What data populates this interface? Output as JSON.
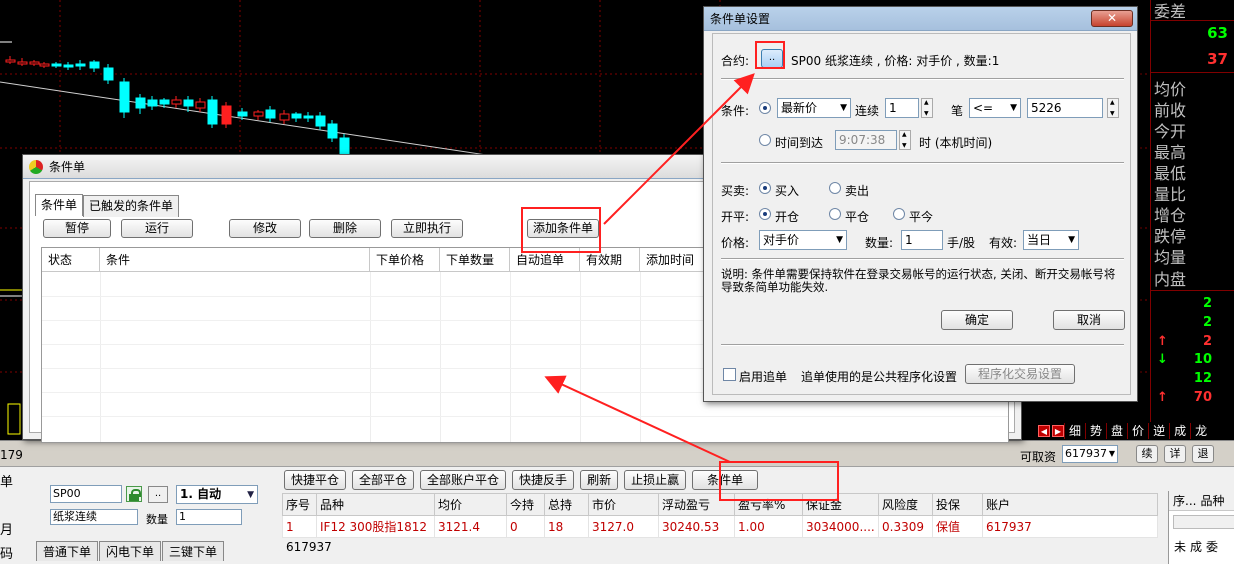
{
  "quote_panel": {
    "labels": [
      "委差",
      "均价",
      "前收",
      "今开",
      "最高",
      "最低",
      "量比",
      "增仓",
      "跌停",
      "均量",
      "内盘"
    ],
    "values": [
      {
        "text": "63",
        "color": "#00ff00"
      },
      {
        "text": "37",
        "color": "#ff3030"
      }
    ],
    "tick_rows": [
      {
        "arrow": "",
        "value": "2"
      },
      {
        "arrow": "",
        "value": "2"
      },
      {
        "arrow": "↑",
        "value": "2"
      },
      {
        "arrow": "↓",
        "value": "10"
      },
      {
        "arrow": "",
        "value": "12"
      },
      {
        "arrow": "↑",
        "value": "70"
      }
    ],
    "tabs": [
      "细",
      "势",
      "盘",
      "价",
      "逆",
      "成",
      "龙"
    ]
  },
  "status_strip": {
    "left_text": "179",
    "label": "可取资",
    "account_select": "617937",
    "buttons": [
      "续",
      "详",
      "退"
    ]
  },
  "trade_panel": {
    "side_labels": [
      "单",
      "月",
      "码"
    ],
    "contract_code": "SP00",
    "browse_label": "..",
    "mode": "1. 自动",
    "contract_name": "纸浆连续",
    "qty_label": "数量",
    "qty_value": "1",
    "order_tabs": [
      "普通下单",
      "闪电下单",
      "三键下单"
    ],
    "account_code": "617937",
    "quick_buttons": [
      "快捷平仓",
      "全部平仓",
      "全部账户平仓",
      "快捷反手",
      "刷新",
      "止损止赢",
      "条件单"
    ],
    "position_headers": [
      "序号",
      "品种",
      "均价",
      "今持",
      "总持",
      "市价",
      "浮动盈亏",
      "盈亏率%",
      "保证金",
      "风险度",
      "投保",
      "账户"
    ],
    "position_rows": [
      [
        "1",
        "IF12 300股指1812",
        "3121.4",
        "0",
        "18",
        "3127.0",
        "30240.53",
        "1.00",
        "3034000....",
        "0.3309",
        "保值",
        "617937"
      ]
    ],
    "right_headers": [
      "序...",
      "品种"
    ],
    "right_tabs": [
      "未",
      "成",
      "委"
    ]
  },
  "cond_window": {
    "title": "条件单",
    "tabs": [
      "条件单",
      "已触发的条件单"
    ],
    "toolbar": {
      "pause": "暂停",
      "run": "运行",
      "edit": "修改",
      "delete": "删除",
      "execute": "立即执行",
      "add": "添加条件单"
    },
    "columns": [
      "状态",
      "条件",
      "下单价格",
      "下单数量",
      "自动追单",
      "有效期",
      "添加时间"
    ]
  },
  "settings_dialog": {
    "title": "条件单设置",
    "close_label": "✕",
    "contract_label": "合约:",
    "browse_label": "..",
    "contract_summary": "SP00 纸浆连续 , 价格: 对手价 , 数量:1",
    "condition_label": "条件:",
    "price_type": "最新价",
    "consecutive_label": "连续",
    "consecutive_value": "1",
    "ticks_label": "笔",
    "operator": "<=",
    "trigger_price": "5226",
    "time_label": "时间到达",
    "time_value": "9:07:38",
    "time_suffix": "时 (本机时间)",
    "side_label": "买卖:",
    "buy": "买入",
    "sell": "卖出",
    "open_close_label": "开平:",
    "open": "开仓",
    "close": "平仓",
    "close_today": "平今",
    "price_label": "价格:",
    "price_value": "对手价",
    "qty_label": "数量:",
    "qty_value": "1",
    "qty_unit": "手/股",
    "valid_label": "有效:",
    "valid_value": "当日",
    "note": "说明: 条件单需要保持软件在登录交易帐号的运行状态, 关闭、断开交易帐号将导致条简单功能失效.",
    "ok": "确定",
    "cancel": "取消",
    "chase_label": "启用追单",
    "chase_note": "追单使用的是公共程序化设置",
    "prog_button": "程序化交易设置"
  },
  "colors": {
    "annotation_red": "#ff2020",
    "loss_red": "#c00000",
    "up_candle": "#ff2020",
    "down_candle": "#00ffff"
  }
}
